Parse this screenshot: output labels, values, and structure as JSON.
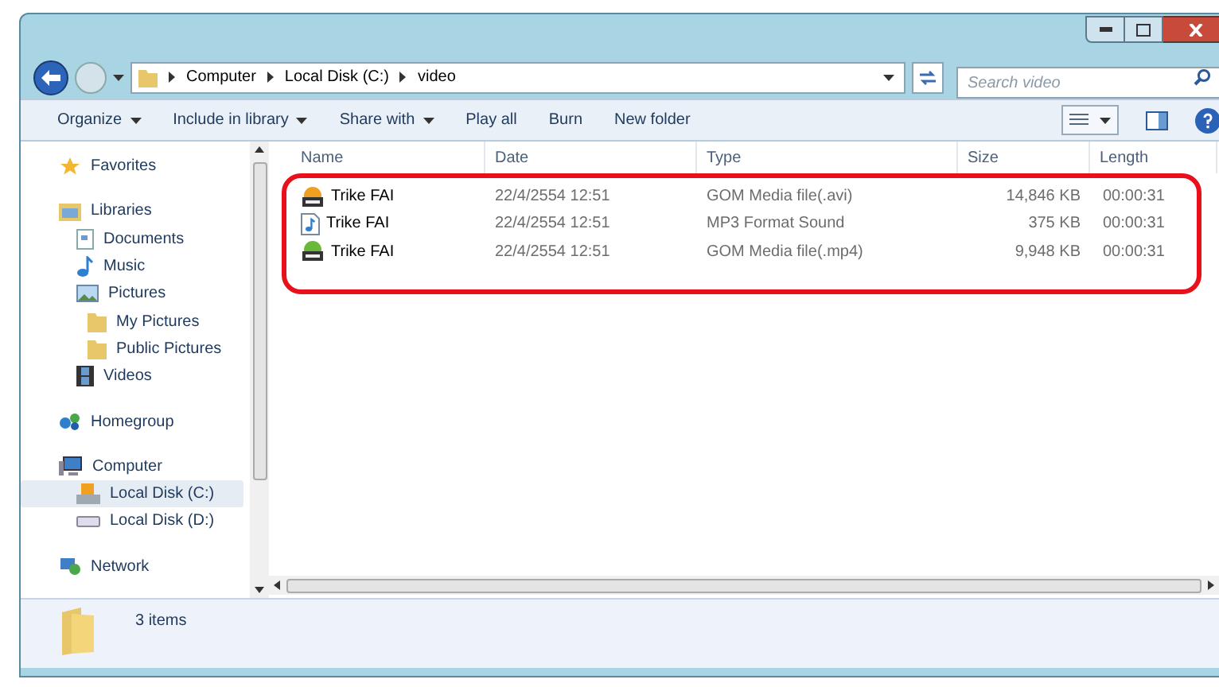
{
  "address_bar": {
    "crumbs": [
      "Computer",
      "Local Disk (C:)",
      "video"
    ],
    "search_placeholder": "Search video"
  },
  "toolbar": {
    "items": [
      {
        "label": "Organize",
        "dropdown": true
      },
      {
        "label": "Include in library",
        "dropdown": true
      },
      {
        "label": "Share with",
        "dropdown": true
      },
      {
        "label": "Play all",
        "dropdown": false
      },
      {
        "label": "Burn",
        "dropdown": false
      },
      {
        "label": "New folder",
        "dropdown": false
      }
    ]
  },
  "sidebar": {
    "items": [
      {
        "label": "Favorites",
        "kind": "star",
        "selected": false
      },
      {
        "label": "Libraries",
        "kind": "library",
        "selected": false,
        "children": [
          {
            "label": "Documents",
            "kind": "document",
            "selected": false
          },
          {
            "label": "Music",
            "kind": "music",
            "selected": false
          },
          {
            "label": "Pictures",
            "kind": "picture",
            "selected": false,
            "children": [
              {
                "label": "My Pictures",
                "kind": "folder",
                "selected": false
              },
              {
                "label": "Public Pictures",
                "kind": "folder",
                "selected": false
              }
            ]
          },
          {
            "label": "Videos",
            "kind": "film",
            "selected": false
          }
        ]
      },
      {
        "label": "Homegroup",
        "kind": "homegroup",
        "selected": false
      },
      {
        "label": "Computer",
        "kind": "computer",
        "selected": false,
        "children": [
          {
            "label": "Local Disk (C:)",
            "kind": "disk",
            "selected": true
          },
          {
            "label": "Local Disk (D:)",
            "kind": "drive",
            "selected": false
          }
        ]
      },
      {
        "label": "Network",
        "kind": "network",
        "selected": false
      }
    ]
  },
  "table": {
    "columns": [
      "Name",
      "Date",
      "Type",
      "Size",
      "Length"
    ],
    "rows": [
      {
        "kind": "avi",
        "name": "Trike FAI",
        "date": "22/4/2554 12:51",
        "type": "GOM Media file(.avi)",
        "size": "14,846 KB",
        "length": "00:00:31"
      },
      {
        "kind": "mp3",
        "name": "Trike FAI",
        "date": "22/4/2554 12:51",
        "type": "MP3 Format Sound",
        "size": "375 KB",
        "length": "00:00:31"
      },
      {
        "kind": "mp4",
        "name": "Trike FAI",
        "date": "22/4/2554 12:51",
        "type": "GOM Media file(.mp4)",
        "size": "9,948 KB",
        "length": "00:00:31"
      }
    ]
  },
  "status_bar": {
    "text": "3 items"
  }
}
